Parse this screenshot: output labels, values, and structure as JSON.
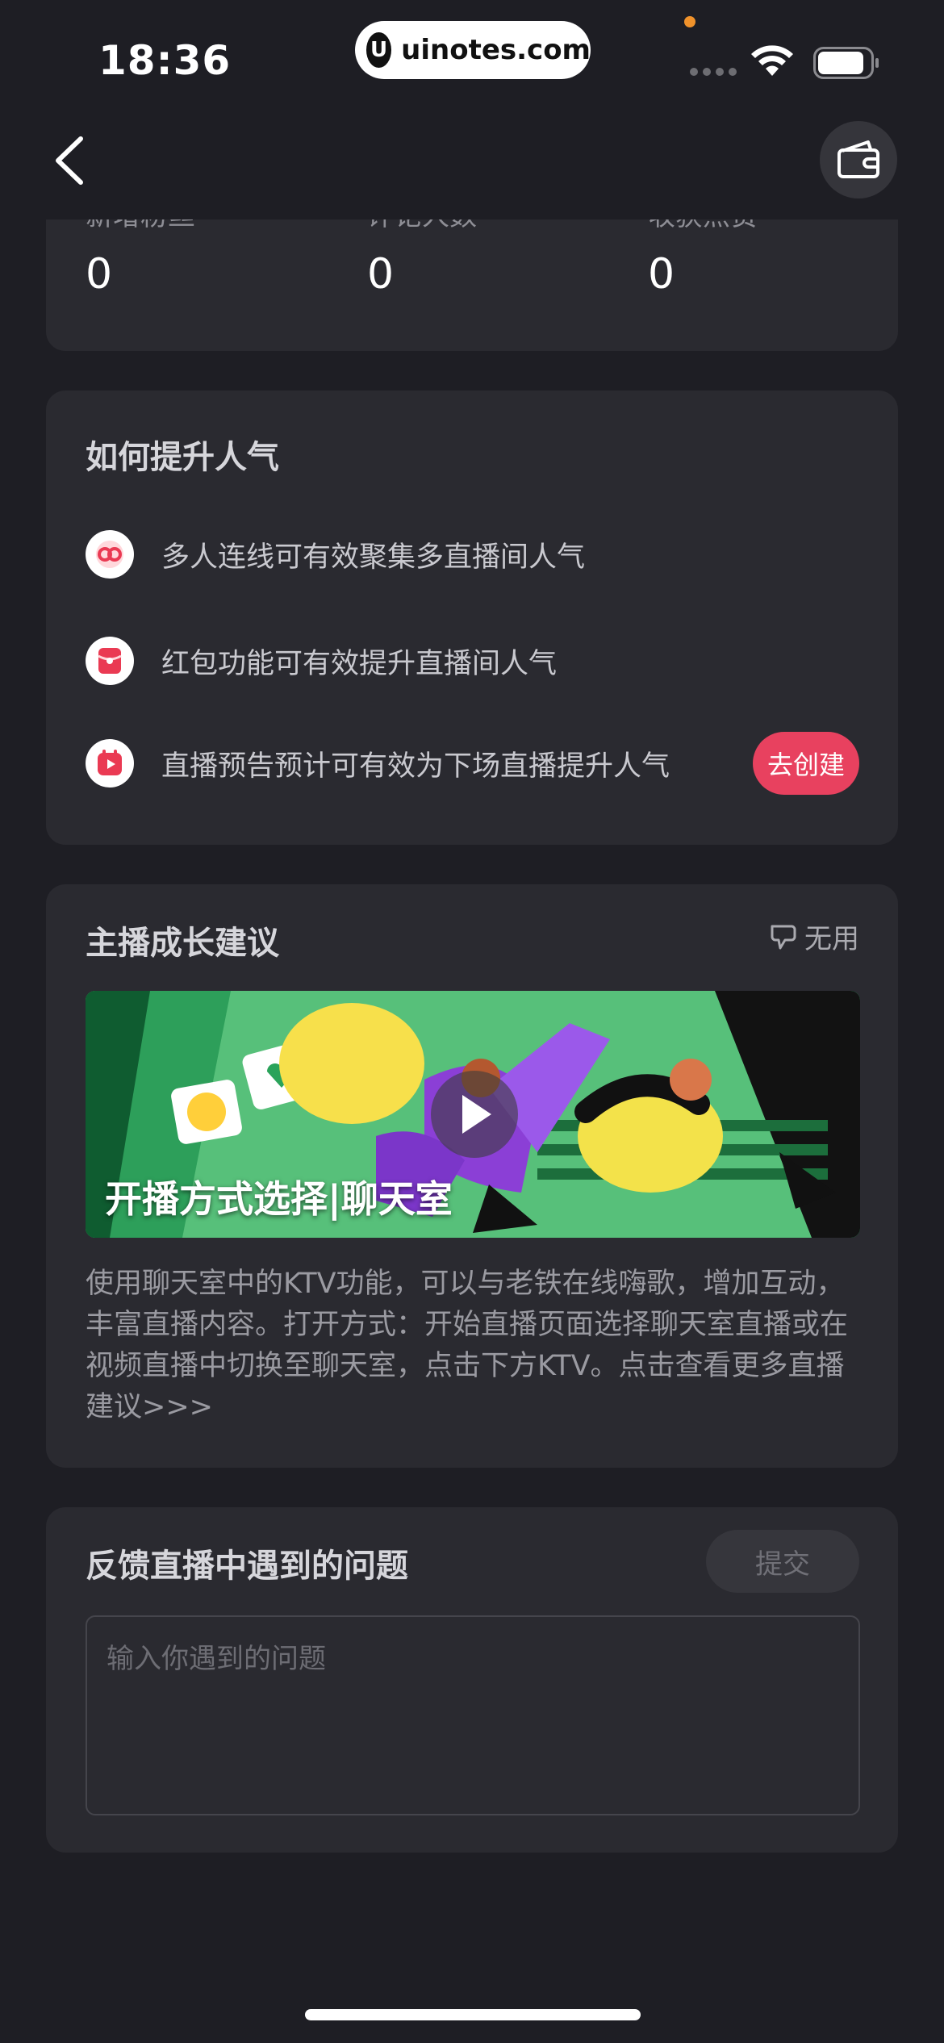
{
  "status_bar": {
    "time": "18:36",
    "url": "uinotes.com",
    "url_logo_letter": "U"
  },
  "stats": [
    {
      "label": "新增粉丝",
      "value": "0"
    },
    {
      "label": "评论人数",
      "value": "0"
    },
    {
      "label": "收获点赞",
      "value": "0"
    }
  ],
  "tips": {
    "title": "如何提升人气",
    "items": [
      {
        "icon": "link-icon",
        "text": "多人连线可有效聚集多直播间人气"
      },
      {
        "icon": "red-packet-icon",
        "text": "红包功能可有效提升直播间人气"
      },
      {
        "icon": "calendar-play-icon",
        "text": "直播预告预计可有效为下场直播提升人气"
      }
    ],
    "create_button": "去创建"
  },
  "growth": {
    "title": "主播成长建议",
    "useless_label": "无用",
    "video_caption": "开播方式选择|聊天室",
    "description": "使用聊天室中的KTV功能，可以与老铁在线嗨歌，增加互动，丰富直播内容。打开方式：开始直播页面选择聊天室直播或在视频直播中切换至聊天室，点击下方KTV。点击查看更多直播建议>>>"
  },
  "feedback": {
    "title": "反馈直播中遇到的问题",
    "submit_label": "提交",
    "placeholder": "输入你遇到的问题",
    "value": ""
  },
  "colors": {
    "background": "#1e1e24",
    "card": "#2a2a30",
    "accent": "#e8415f"
  }
}
